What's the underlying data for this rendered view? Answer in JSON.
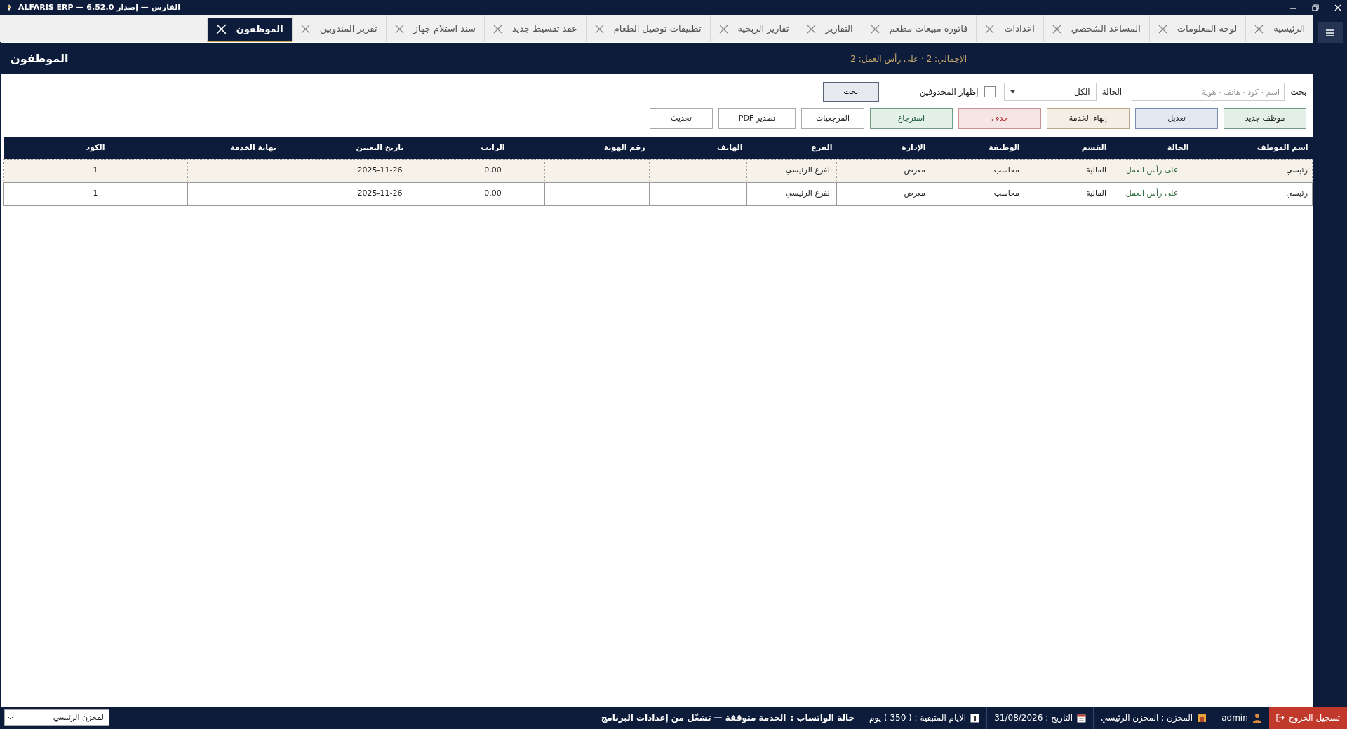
{
  "window": {
    "title": "ALFARIS ERP — الفارس — إصدار 6.52.0"
  },
  "tabs": [
    {
      "label": "الرئيسية",
      "selected": false
    },
    {
      "label": "لوحة المعلومات",
      "selected": false
    },
    {
      "label": "المساعد الشخصي",
      "selected": false
    },
    {
      "label": "اعدادات",
      "selected": false
    },
    {
      "label": "فاتورة مبيعات مطعم",
      "selected": false
    },
    {
      "label": "التقارير",
      "selected": false
    },
    {
      "label": "تقارير الربحية",
      "selected": false
    },
    {
      "label": "تطبيقات توصيل الطعام",
      "selected": false
    },
    {
      "label": "عقد تقسيط جديد",
      "selected": false
    },
    {
      "label": "سند استلام جهاز",
      "selected": false
    },
    {
      "label": "تقرير المندوبين",
      "selected": false
    },
    {
      "label": "الموظفون",
      "selected": true
    }
  ],
  "header": {
    "title": "الموظفون",
    "summary": "الإجمالي: 2  ·  على رأس العمل: 2"
  },
  "filters": {
    "search_label": "بحث",
    "search_placeholder": "اسم · كود · هاتف · هوية",
    "status_label": "الحالة",
    "status_value": "الكل",
    "show_deleted": {
      "label": "إظهار المحذوفين",
      "checked": false
    },
    "search_button": "بحث"
  },
  "buttons": [
    {
      "label": "موظف جديد",
      "kind": "new"
    },
    {
      "label": "تعديل",
      "kind": "edit"
    },
    {
      "label": "إنهاء الخدمة",
      "kind": "end"
    },
    {
      "label": "حذف",
      "kind": "delete"
    },
    {
      "label": "استرجاع",
      "kind": "restore"
    },
    {
      "label": "المرجعيات",
      "kind": "plain"
    },
    {
      "label": "تصدير PDF",
      "kind": "plain"
    },
    {
      "label": "تحديث",
      "kind": "plain"
    }
  ],
  "table": {
    "columns": [
      "اسم الموظف",
      "الحالة",
      "القسم",
      "الوظيفة",
      "الإدارة",
      "الفرع",
      "الهاتف",
      "رقم الهوية",
      "الراتب",
      "تاريخ التعيين",
      "نهاية الخدمة",
      "الكود"
    ],
    "rows": [
      {
        "selected": true,
        "cells": [
          "رئيسي",
          "على رأس العمل",
          "المالية",
          "محاسب",
          "معرض",
          "الفرع الرئيسي",
          null,
          null,
          "0.00",
          "2025-11-26",
          null,
          "1"
        ]
      },
      {
        "selected": false,
        "cells": [
          "رئيسي",
          "على رأس العمل",
          "المالية",
          "محاسب",
          "معرض",
          "الفرع الرئيسي",
          null,
          null,
          "0.00",
          "2025-11-26",
          null,
          "1"
        ]
      }
    ]
  },
  "status_bar": {
    "warehouse_select": "المخزن الرئيسي",
    "items": [
      {
        "kind": "logout",
        "text": "تسجيل الخروج"
      },
      {
        "kind": "user",
        "text": "admin"
      },
      {
        "kind": "store",
        "text": "المخزن : المخزن الرئيسي"
      },
      {
        "kind": "date",
        "text": "التاريخ : 31/08/2026"
      },
      {
        "kind": "days",
        "text": "الايام المتبقية : ( 350 ) يوم"
      },
      {
        "kind": "whatsapp",
        "label": "حالة الواتساب :",
        "text": "الخدمة متوقفة — تشغّل من إعدادات البرنامج"
      }
    ]
  }
}
